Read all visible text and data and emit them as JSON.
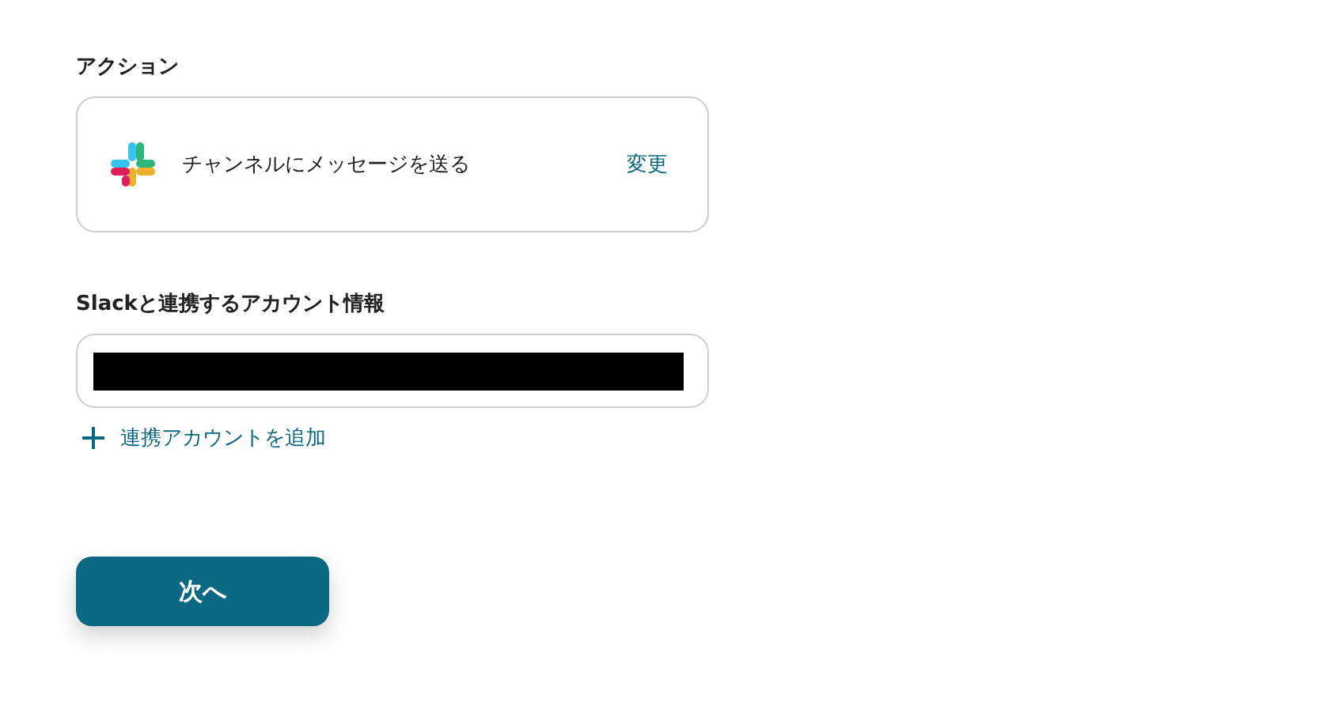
{
  "action_section": {
    "label": "アクション",
    "action_name": "チャンネルにメッセージを送る",
    "change_link": "変更"
  },
  "account_section": {
    "label": "Slackと連携するアカウント情報",
    "account_field": {
      "redacted": true
    },
    "add_link": "連携アカウントを追加"
  },
  "buttons": [
    "次へ"
  ]
}
